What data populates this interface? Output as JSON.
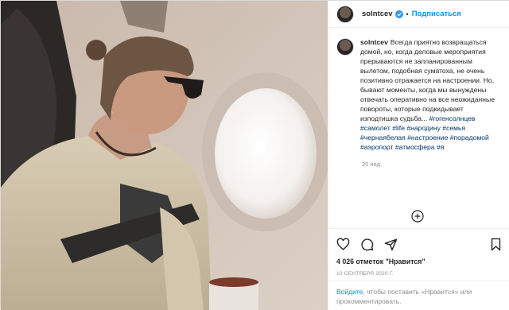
{
  "post": {
    "author": {
      "username": "solntcev",
      "verified": true,
      "avatar_icon": "avatar-image"
    },
    "follow_label": "Подписаться",
    "separator": "•",
    "caption": {
      "username": "solntcev",
      "text": "Всегда приятно возвращаться домой, но, когда деловые мероприятия прерываются не запланированным вылетом, подобная суматоха, не очень позитивно отражается на настроении. Но, бывают моменты, когда мы вынуждены отвечать оперативно на все неожиданные повороты, которые подкидывает изподтишка судьба...",
      "hashtags": [
        "#гогенсолнцев",
        "#самолет",
        "#life",
        "#народину",
        "#семья",
        "#чернаябелая",
        "#настроение",
        "#порадомой",
        "#аэропорт",
        "#атмосфера",
        "#я"
      ],
      "age": "20 нед."
    },
    "load_more_icon": "plus-circle-icon",
    "actions": {
      "icons": [
        "heart-icon",
        "comment-icon",
        "share-icon",
        "bookmark-icon"
      ]
    },
    "likes": "4 026 отметок \"Нравится\"",
    "date": "10 СЕНТЯБРЯ 2020 Г.",
    "login_prompt": {
      "link": "Войдите",
      "rest": ", чтобы поставить «Нравится» или прокомментировать."
    }
  },
  "colors": {
    "link_blue": "#0095f6",
    "hashtag_blue": "#00376b",
    "muted_gray": "#8e8e8e",
    "border": "#dbdbdb"
  }
}
